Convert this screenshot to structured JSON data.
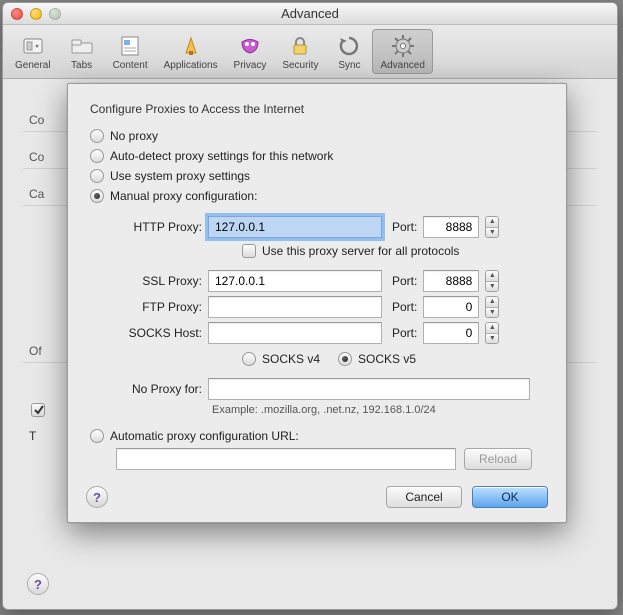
{
  "window": {
    "title": "Advanced"
  },
  "toolbar": {
    "general": "General",
    "tabs": "Tabs",
    "content": "Content",
    "applications": "Applications",
    "privacy": "Privacy",
    "security": "Security",
    "sync": "Sync",
    "advanced": "Advanced"
  },
  "bg": {
    "co1": "Co",
    "co2": "Co",
    "ca": "Ca",
    "of": "Of",
    "t": "T"
  },
  "sheet": {
    "heading": "Configure Proxies to Access the Internet",
    "opt_no_proxy": "No proxy",
    "opt_auto_detect": "Auto-detect proxy settings for this network",
    "opt_system": "Use system proxy settings",
    "opt_manual": "Manual proxy configuration:",
    "opt_auto_url": "Automatic proxy configuration URL:",
    "http_label": "HTTP Proxy:",
    "ssl_label": "SSL Proxy:",
    "ftp_label": "FTP Proxy:",
    "socks_label": "SOCKS Host:",
    "port_label": "Port:",
    "use_for_all": "Use this proxy server for all protocols",
    "socks_v4": "SOCKS v4",
    "socks_v5": "SOCKS v5",
    "no_proxy_for_label": "No Proxy for:",
    "example": "Example: .mozilla.org, .net.nz, 192.168.1.0/24",
    "reload": "Reload",
    "cancel": "Cancel",
    "ok": "OK",
    "http_host": "127.0.0.1",
    "http_port": "8888",
    "ssl_host": "127.0.0.1",
    "ssl_port": "8888",
    "ftp_host": "",
    "ftp_port": "0",
    "socks_host": "",
    "socks_port": "0",
    "no_proxy_for_value": "",
    "auto_url_value": ""
  },
  "help": "?"
}
